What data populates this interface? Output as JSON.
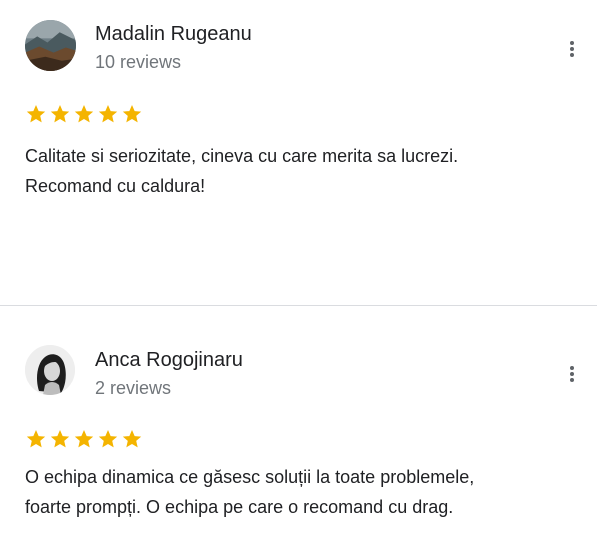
{
  "colors": {
    "star": "#f4b400",
    "name": "#202124",
    "secondary": "#70757a",
    "divider": "#dadce0"
  },
  "reviews": [
    {
      "author": "Madalin Rugeanu",
      "review_count": "10 reviews",
      "rating": 5,
      "text_lines": [
        "Calitate si seriozitate, cineva cu care merita sa lucrezi.",
        "Recomand cu caldura!"
      ]
    },
    {
      "author": "Anca Rogojinaru",
      "review_count": "2 reviews",
      "rating": 5,
      "text_lines": [
        "O echipa dinamica ce găsesc soluții la toate problemele,",
        "foarte prompți. O echipa pe care o recomand cu drag."
      ]
    }
  ]
}
